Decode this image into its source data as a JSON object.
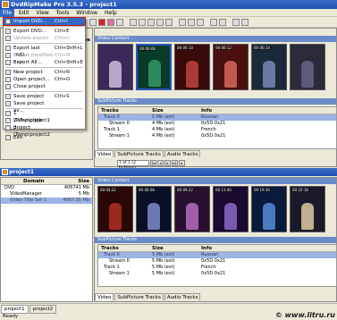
{
  "window": {
    "title": "DvdRipMake Pro 3.5.3 - project1"
  },
  "menubar": [
    "File",
    "Edit",
    "View",
    "Tools",
    "Window",
    "Help"
  ],
  "file_menu": [
    {
      "label": "Import DVD...",
      "shortcut": "Ctrl+I",
      "state": "highlighted"
    },
    {
      "label": "Export DVD...",
      "shortcut": "Ctrl+E",
      "state": "normal"
    },
    {
      "label": "Update export",
      "shortcut": "Ctrl+U",
      "state": "disabled"
    },
    {
      "label": "Export last DVD...",
      "shortcut": "Ctrl+Shift+L",
      "state": "normal"
    },
    {
      "label": "Export modified files",
      "shortcut": "Ctrl+M",
      "state": "disabled"
    },
    {
      "label": "Export All...",
      "shortcut": "Ctrl+Shift+E",
      "state": "normal"
    },
    {
      "label": "New project",
      "shortcut": "Ctrl+N",
      "state": "normal"
    },
    {
      "label": "Open project...",
      "shortcut": "Ctrl+O",
      "state": "normal"
    },
    {
      "label": "Close project",
      "shortcut": "",
      "state": "normal"
    },
    {
      "label": "Save project",
      "shortcut": "Ctrl+S",
      "state": "normal"
    },
    {
      "label": "Save project as...",
      "shortcut": "",
      "state": "normal"
    },
    {
      "label": "1 \\Temp\\project1",
      "shortcut": "",
      "state": "normal"
    },
    {
      "label": "2 \\Temp\\join project",
      "shortcut": "",
      "state": "normal"
    },
    {
      "label": "3 \\Temp\\project2",
      "shortcut": "",
      "state": "normal"
    },
    {
      "label": "Exit",
      "shortcut": "",
      "state": "normal"
    }
  ],
  "top": {
    "size_col": "Size",
    "video_header": "Video Content",
    "subpicture_header": "SubPicture Tracks",
    "table_headers": {
      "tracks": "Tracks",
      "size": "Size",
      "info": "Info"
    },
    "rows": [
      {
        "track": "Track 0",
        "size": "0 Mb (est)",
        "info": "Russian",
        "selected": true
      },
      {
        "track": "Stream 0",
        "size": "4 Mb (est)",
        "info": "0x5D 0x21",
        "selected": false
      },
      {
        "track": "Track 1",
        "size": "4 Mb (est)",
        "info": "French",
        "selected": false
      },
      {
        "track": "Stream 1",
        "size": "4 Mb (est)",
        "info": "0x5D 0x21",
        "selected": false
      }
    ],
    "tabs": [
      "Video",
      "SubPicture Tracks",
      "Audio Tracks"
    ],
    "nav_field": "1 of 1 (2 buttons)"
  },
  "bottom": {
    "title": "project1",
    "tree_headers": {
      "domain": "Domain",
      "size": "Size"
    },
    "tree": [
      {
        "domain": "DVD",
        "size": "406741 Mb",
        "selected": false
      },
      {
        "domain": "VideoManager",
        "size": "5 Mb",
        "selected": false
      },
      {
        "domain": "Video Title Set 1",
        "size": "4087.95 Mb",
        "selected": true
      }
    ],
    "video_header": "Video Content",
    "subpicture_header": "SubPicture Tracks",
    "table_headers": {
      "tracks": "Tracks",
      "size": "Size",
      "info": "Info"
    },
    "rows": [
      {
        "track": "Track 0",
        "size": "5 Mb (est)",
        "info": "Russian",
        "selected": true
      },
      {
        "track": "Stream 0",
        "size": "5 Mb (est)",
        "info": "0x5D 0x21",
        "selected": false
      },
      {
        "track": "Track 1",
        "size": "5 Mb (est)",
        "info": "French",
        "selected": false
      },
      {
        "track": "Stream 1",
        "size": "5 Mb (est)",
        "info": "0x5D 0x21",
        "selected": false
      }
    ],
    "tabs": [
      "Video",
      "SubPicture Tracks",
      "Audio Tracks"
    ]
  },
  "thumbs_top": [
    {
      "tc": "",
      "fill": "#3a2a5a",
      "fig": "#b8a8c8",
      "selected": false
    },
    {
      "tc": "00:00:08",
      "fill": "#0a3a2a",
      "fig": "#2c8a5a",
      "selected": true
    },
    {
      "tc": "00:00:10",
      "fill": "#3a0a0a",
      "fig": "#a83a3a",
      "selected": false
    },
    {
      "tc": "00:00:12",
      "fill": "#4a1010",
      "fig": "#c05a50",
      "selected": false
    },
    {
      "tc": "00:00:14",
      "fill": "#1a2a3a",
      "fig": "#6a7aa0",
      "selected": false
    },
    {
      "tc": "",
      "fill": "#2a2a3a",
      "fig": "#5a5a7a",
      "selected": false
    }
  ],
  "thumbs_bottom": [
    {
      "tc": "00:04:22",
      "fill": "#2a0808",
      "fig": "#9a2a20",
      "selected": false
    },
    {
      "tc": "00:06:08",
      "fill": "#0a1028",
      "fig": "#6a7ab0",
      "selected": false
    },
    {
      "tc": "00:09:22",
      "fill": "#2a1030",
      "fig": "#a060a8",
      "selected": false
    },
    {
      "tc": "00:13:40",
      "fill": "#1a0a30",
      "fig": "#7a5ab0",
      "selected": false
    },
    {
      "tc": "00:19:30",
      "fill": "#0a1a3a",
      "fig": "#4a7ac0",
      "selected": false
    },
    {
      "tc": "00:22:18",
      "fill": "#1a1a2a",
      "fig": "#c0b090",
      "selected": false
    }
  ],
  "doc_tabs": [
    "project1",
    "project2"
  ],
  "status": "Ready",
  "watermark": "© www.litru.ru"
}
